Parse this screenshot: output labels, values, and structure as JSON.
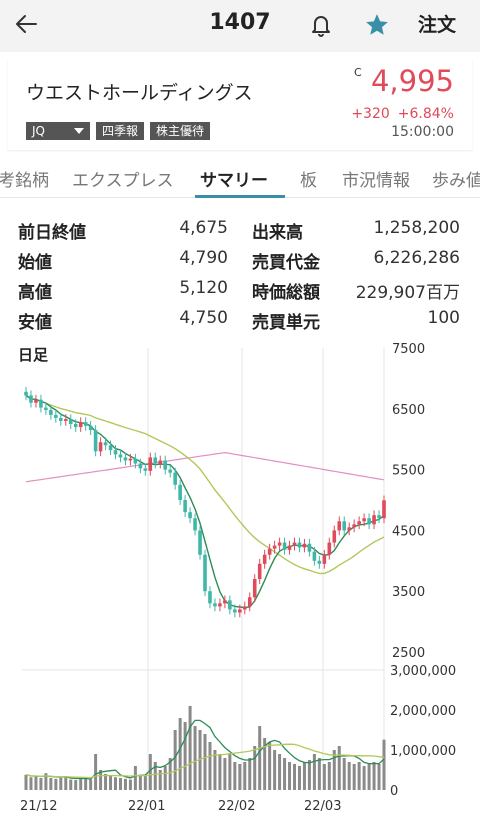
{
  "header": {
    "code": "1407",
    "order_label": "注文",
    "star_color": "#3a8fa8"
  },
  "stock": {
    "name": "ウエストホールディングス",
    "market": "JQ",
    "badges": [
      "四季報",
      "株主優待"
    ],
    "flag": "C",
    "price": "4,995",
    "change": "+320",
    "change_pct": "+6.84%",
    "time": "15:00:00",
    "up_color": "#e04a5a"
  },
  "tabs": [
    {
      "label": "考銘柄",
      "active": false
    },
    {
      "label": "エクスプレス",
      "active": false
    },
    {
      "label": "サマリー",
      "active": true
    },
    {
      "label": "板",
      "active": false
    },
    {
      "label": "市況情報",
      "active": false
    },
    {
      "label": "歩み値",
      "active": false
    }
  ],
  "stats": [
    {
      "k1": "前日終値",
      "v1": "4,675",
      "k2": "出来高",
      "v2": "1,258,200"
    },
    {
      "k1": "始値",
      "v1": "4,790",
      "k2": "売買代金",
      "v2": "6,226,286"
    },
    {
      "k1": "高値",
      "v1": "5,120",
      "k2": "時価総額",
      "v2": "229,907百万"
    },
    {
      "k1": "安値",
      "v1": "4,750",
      "k2": "売買単元",
      "v2": "100"
    }
  ],
  "chart": {
    "label": "日足",
    "price_ticks": [
      "7500",
      "6500",
      "5500",
      "4500",
      "3500",
      "2500"
    ],
    "volume_ticks": [
      "3,000,000",
      "2,000,000",
      "1,000,000",
      "0"
    ],
    "date_ticks": [
      "21/12",
      "22/01",
      "22/02",
      "22/03"
    ]
  },
  "chart_data": {
    "type": "candlestick",
    "price_axis": [
      2500,
      7500
    ],
    "volume_axis": [
      0,
      3000000
    ],
    "closes": [
      6720,
      6600,
      6650,
      6520,
      6480,
      6400,
      6350,
      6300,
      6330,
      6250,
      6200,
      6280,
      6220,
      6150,
      5800,
      5950,
      5900,
      5820,
      5750,
      5700,
      5650,
      5680,
      5600,
      5520,
      5480,
      5700,
      5600,
      5650,
      5500,
      5450,
      5250,
      5000,
      4800,
      4700,
      4500,
      4100,
      3500,
      3300,
      3250,
      3300,
      3350,
      3200,
      3150,
      3200,
      3250,
      3400,
      3700,
      3950,
      4100,
      4200,
      4250,
      4300,
      4180,
      4250,
      4300,
      4220,
      4280,
      4150,
      4000,
      3950,
      4100,
      4300,
      4500,
      4650,
      4500,
      4550,
      4600,
      4650,
      4700,
      4600,
      4750,
      4700,
      4995
    ],
    "volumes": [
      380000,
      320000,
      350000,
      300000,
      420000,
      300000,
      280000,
      300000,
      350000,
      260000,
      250000,
      300000,
      280000,
      260000,
      900000,
      500000,
      400000,
      350000,
      320000,
      300000,
      280000,
      260000,
      600000,
      380000,
      350000,
      900000,
      700000,
      500000,
      600000,
      800000,
      1500000,
      1800000,
      1700000,
      2100000,
      1600000,
      1500000,
      1400000,
      1200000,
      1000000,
      900000,
      800000,
      900000,
      700000,
      650000,
      700000,
      800000,
      1100000,
      1600000,
      1300000,
      1200000,
      1000000,
      900000,
      800000,
      700000,
      650000,
      600000,
      700000,
      750000,
      900000,
      800000,
      650000,
      700000,
      1000000,
      1100000,
      800000,
      700000,
      650000,
      700000,
      600000,
      650000,
      700000,
      650000,
      1258200
    ]
  }
}
